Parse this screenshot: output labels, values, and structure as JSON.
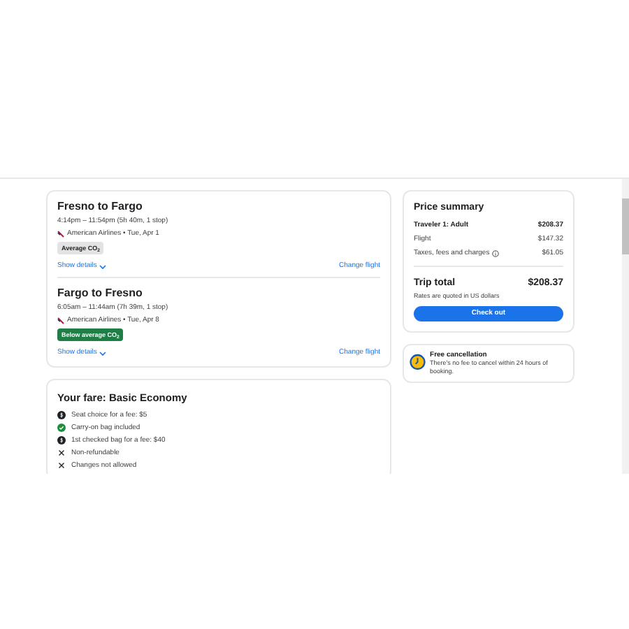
{
  "flights": [
    {
      "title": "Fresno to Fargo",
      "times": "4:14pm – 11:54pm (5h 40m, 1 stop)",
      "airline": "American Airlines • Tue, Apr 1",
      "badge": {
        "kind": "average",
        "label": "Average CO$_{2}$"
      },
      "details_link": "Show details",
      "change_link": "Change flight"
    },
    {
      "title": "Fargo to Fresno",
      "times": "6:05am – 11:44am (7h 39m, 1 stop)",
      "airline": "American Airlines • Tue, Apr 8",
      "badge": {
        "kind": "below",
        "label": "Below average CO$_{2}$"
      },
      "details_link": "Show details",
      "change_link": "Change flight"
    }
  ],
  "fare": {
    "title": "Your fare: Basic Economy",
    "items": [
      {
        "kind": "fee",
        "text": "Seat choice for a fee: $5"
      },
      {
        "kind": "included",
        "text": "Carry-on bag included"
      },
      {
        "kind": "fee",
        "text": "1st checked bag for a fee: $40"
      },
      {
        "kind": "no",
        "text": "Non-refundable"
      },
      {
        "kind": "no",
        "text": "Changes not allowed"
      }
    ]
  },
  "price_summary": {
    "title": "Price summary",
    "rows": [
      {
        "label": "Traveler 1: Adult",
        "amount": "$208.37",
        "bold": true,
        "info": false
      },
      {
        "label": "Flight",
        "amount": "$147.32",
        "bold": false,
        "info": false
      },
      {
        "label": "Taxes, fees and charges",
        "amount": "$61.05",
        "bold": false,
        "info": true
      }
    ],
    "total_label": "Trip total",
    "total": "$208.37",
    "note": "Rates are quoted in US dollars",
    "button": "Check out"
  },
  "cancellation": {
    "title": "Free cancellation",
    "text": "There's no fee to cancel within 24 hours of booking."
  }
}
